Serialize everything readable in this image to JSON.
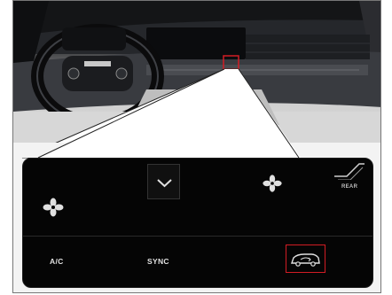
{
  "image_title": "",
  "climate_panel": {
    "row_upper": {
      "down_button_icon": "chevron-down-icon",
      "left_fan_icon": "fan-icon",
      "right_fan_icon": "fan-icon",
      "rear_label": "REAR",
      "rear_icon": "rear-seat-icon"
    },
    "row_lower": {
      "ac_label": "A/C",
      "sync_label": "SYNC",
      "recirc_icon": "car-recirculation-icon"
    }
  },
  "colors": {
    "highlight": "#d21c24",
    "panel_bg": "#050505",
    "panel_text": "#e0e0e0"
  }
}
